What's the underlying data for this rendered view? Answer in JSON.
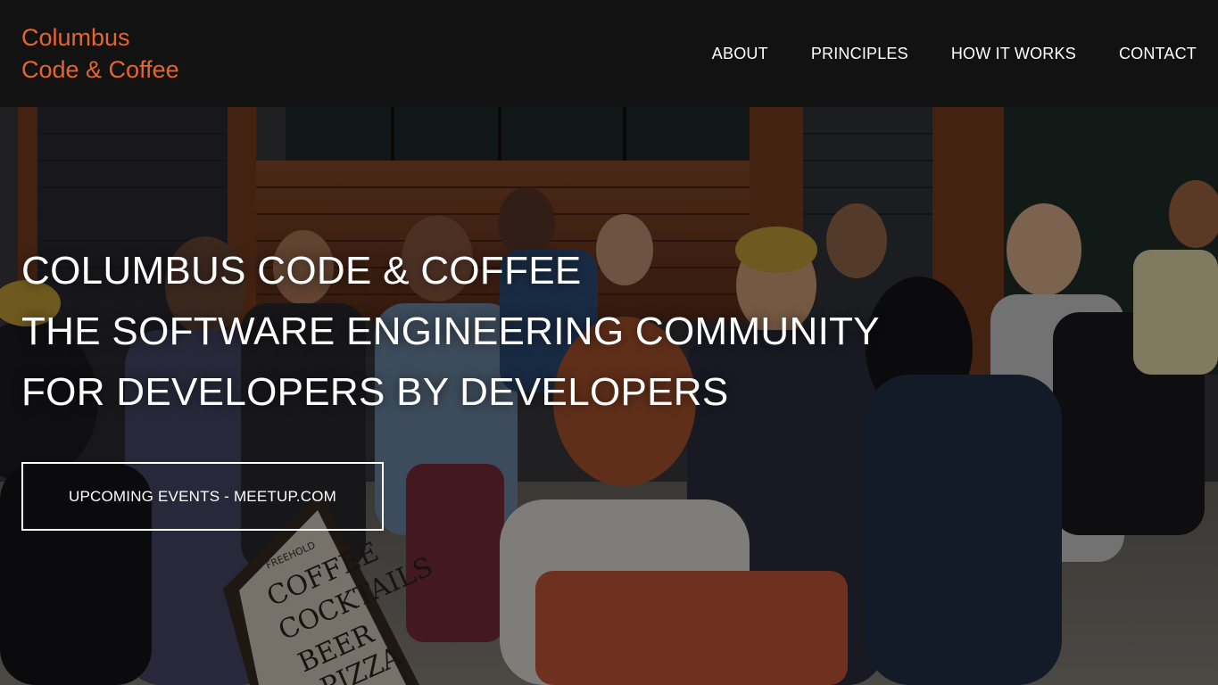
{
  "brand": {
    "line1": "Columbus",
    "line2": "Code & Coffee",
    "color": "#e5652e"
  },
  "nav": {
    "items": [
      {
        "label": "ABOUT"
      },
      {
        "label": "PRINCIPLES"
      },
      {
        "label": "HOW IT WORKS"
      },
      {
        "label": "CONTACT"
      }
    ]
  },
  "hero": {
    "title": "COLUMBUS CODE & COFFEE",
    "line2": "THE SOFTWARE ENGINEERING COMMUNITY",
    "line3": "FOR DEVELOPERS BY DEVELOPERS",
    "cta_label": "UPCOMING EVENTS - MEETUP.COM",
    "sign": {
      "brand": "FREEHOLD",
      "lines": [
        "COFFEE",
        "COCKTAILS",
        "BEER",
        "PIZZA"
      ]
    }
  }
}
